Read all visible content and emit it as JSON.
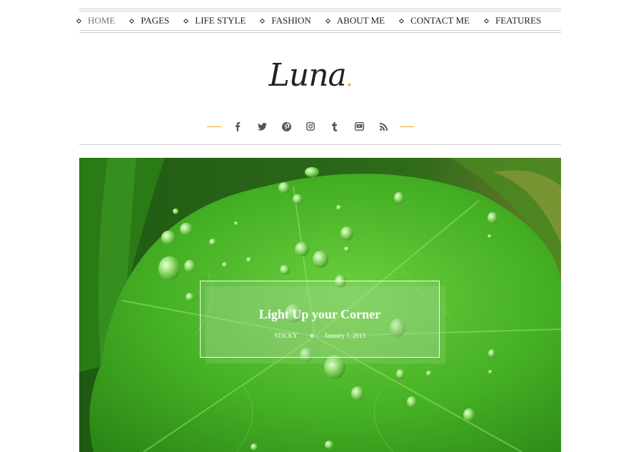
{
  "nav": {
    "items": [
      {
        "label": "HOME",
        "active": true
      },
      {
        "label": "PAGES",
        "active": false
      },
      {
        "label": "LIFE STYLE",
        "active": false
      },
      {
        "label": "FASHION",
        "active": false
      },
      {
        "label": "ABOUT ME",
        "active": false
      },
      {
        "label": "CONTACT ME",
        "active": false
      },
      {
        "label": "FEATURES",
        "active": false
      }
    ]
  },
  "logo": {
    "text": "Luna",
    "dot": ".",
    "accent_color": "#f0a23a"
  },
  "social": {
    "icons": [
      {
        "name": "facebook-icon",
        "glyph": "f"
      },
      {
        "name": "twitter-icon",
        "glyph": "t"
      },
      {
        "name": "pinterest-icon",
        "glyph": "p"
      },
      {
        "name": "instagram-icon",
        "glyph": "◘"
      },
      {
        "name": "tumblr-icon",
        "glyph": "t"
      },
      {
        "name": "youtube-icon",
        "glyph": "▶"
      },
      {
        "name": "rss-icon",
        "glyph": "≋"
      }
    ]
  },
  "featured": {
    "title": "Light Up your Corner",
    "category": "STICKY",
    "date": "January 7, 2013"
  }
}
